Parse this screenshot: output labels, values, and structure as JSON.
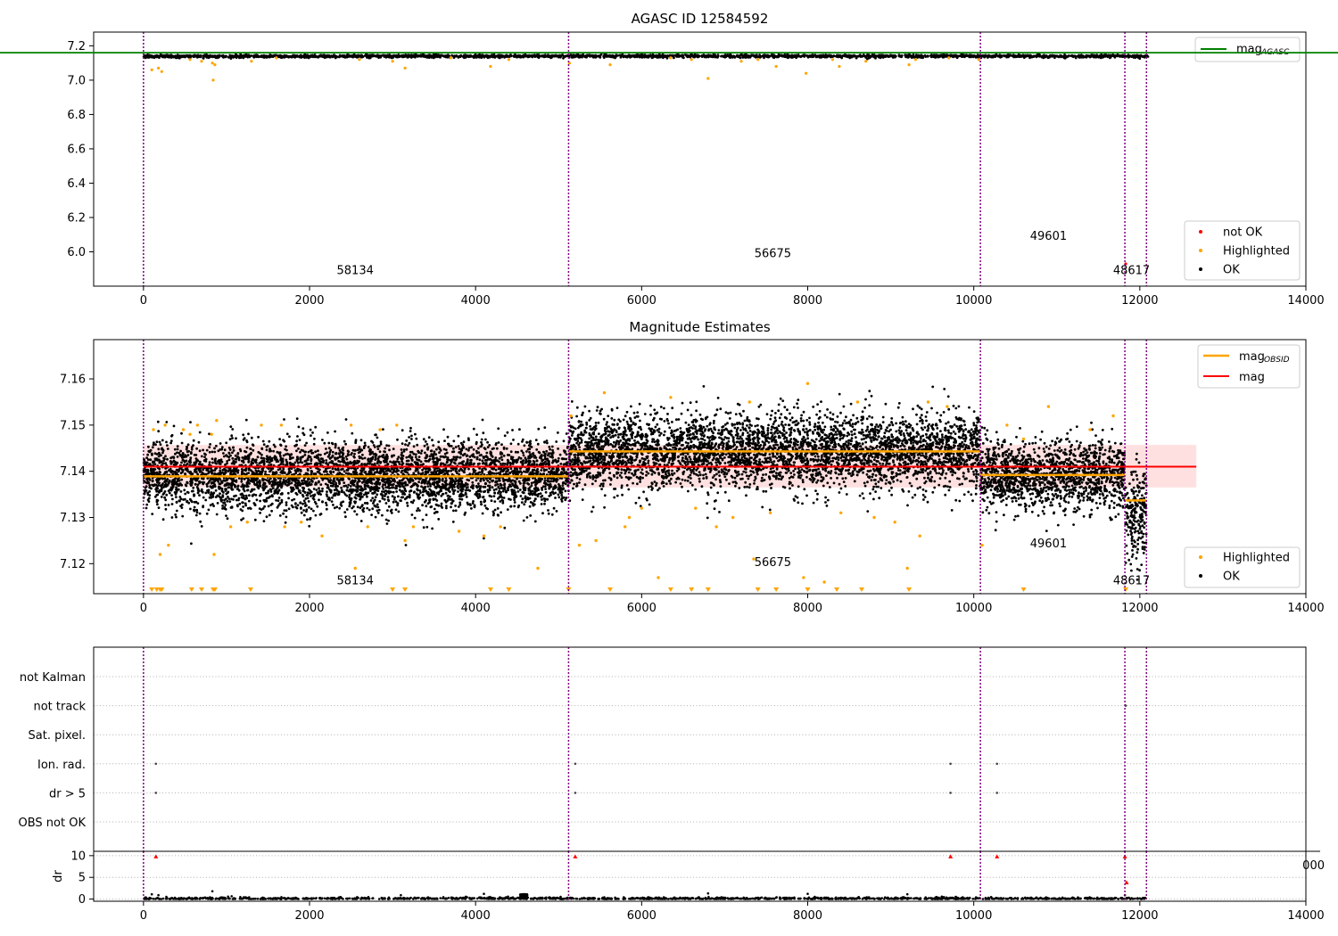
{
  "colors": {
    "ok": "#000000",
    "highlighted": "#ffa500",
    "not_ok": "#ff0000",
    "agasc_line": "#008000",
    "mag_line": "#ff0000",
    "mag_obsid_line": "#ffa500",
    "band": "#ffdddd",
    "obsid_boundary": "#800080"
  },
  "chart_data": [
    {
      "type": "scatter",
      "title": "AGASC ID 12584592",
      "xlim": [
        -600,
        14000
      ],
      "ylim": [
        5.8,
        7.28
      ],
      "x_ticks": [
        0,
        2000,
        4000,
        6000,
        8000,
        10000,
        12000,
        14000
      ],
      "y_ticks": [
        6.0,
        6.2,
        6.4,
        6.6,
        6.8,
        7.0,
        7.2
      ],
      "y_tick_labels": [
        "6.0",
        "6.2",
        "6.4",
        "6.6",
        "6.8",
        "7.0",
        "7.2"
      ],
      "obsid_boundaries": [
        0,
        5120,
        10080,
        11820,
        12080
      ],
      "obsid_labels": [
        {
          "text": "58134",
          "x": 2550,
          "y": 5.87
        },
        {
          "text": "56675",
          "x": 7580,
          "y": 5.97
        },
        {
          "text": "49601",
          "x": 10900,
          "y": 6.07
        },
        {
          "text": "48617",
          "x": 11900,
          "y": 5.87
        }
      ],
      "mag_agasc": 7.16,
      "series": [
        {
          "name": "mag",
          "sub": "AGASC",
          "role": "line"
        },
        {
          "name": "not OK",
          "role": "points"
        },
        {
          "name": "Highlighted",
          "role": "points"
        },
        {
          "name": "OK",
          "role": "points"
        }
      ],
      "legend_line_placement": "top-right",
      "legend_points_placement": "bottom-right",
      "ok_level": 7.14,
      "ok_spread": 0.007,
      "highlighted_points": [
        [
          100,
          7.06
        ],
        [
          180,
          7.07
        ],
        [
          220,
          7.05
        ],
        [
          560,
          7.12
        ],
        [
          700,
          7.11
        ],
        [
          830,
          7.1
        ],
        [
          840,
          7.0
        ],
        [
          860,
          7.09
        ],
        [
          1300,
          7.11
        ],
        [
          1600,
          7.13
        ],
        [
          2600,
          7.12
        ],
        [
          3000,
          7.11
        ],
        [
          3150,
          7.07
        ],
        [
          3700,
          7.13
        ],
        [
          4180,
          7.08
        ],
        [
          4400,
          7.12
        ],
        [
          5130,
          7.1
        ],
        [
          5620,
          7.09
        ],
        [
          6350,
          7.13
        ],
        [
          6600,
          7.12
        ],
        [
          6800,
          7.01
        ],
        [
          7200,
          7.11
        ],
        [
          7400,
          7.12
        ],
        [
          7620,
          7.08
        ],
        [
          7980,
          7.04
        ],
        [
          8300,
          7.12
        ],
        [
          8380,
          7.08
        ],
        [
          8700,
          7.11
        ],
        [
          9220,
          7.09
        ],
        [
          9300,
          7.12
        ],
        [
          9700,
          7.13
        ],
        [
          10060,
          7.12
        ]
      ],
      "not_ok_points": [
        [
          11830,
          5.93
        ]
      ]
    },
    {
      "type": "scatter",
      "title": "Magnitude Estimates",
      "xlim": [
        -600,
        14000
      ],
      "ylim": [
        7.1135,
        7.1685
      ],
      "x_ticks": [
        0,
        2000,
        4000,
        6000,
        8000,
        10000,
        12000,
        14000
      ],
      "y_ticks": [
        7.12,
        7.13,
        7.14,
        7.15,
        7.16
      ],
      "y_tick_labels": [
        "7.12",
        "7.13",
        "7.14",
        "7.15",
        "7.16"
      ],
      "obsid_boundaries": [
        0,
        5120,
        10080,
        11820,
        12080
      ],
      "obsid_labels": [
        {
          "text": "58134",
          "x": 2550,
          "y": 7.1155
        },
        {
          "text": "56675",
          "x": 7580,
          "y": 7.1195
        },
        {
          "text": "49601",
          "x": 10900,
          "y": 7.1235
        },
        {
          "text": "48617",
          "x": 11900,
          "y": 7.1155
        }
      ],
      "mag": 7.141,
      "mag_band": [
        7.1365,
        7.1457
      ],
      "mag_xrange": [
        0,
        12680
      ],
      "mag_obsid": [
        {
          "x0": 0,
          "x1": 5120,
          "y": 7.1389
        },
        {
          "x0": 5120,
          "x1": 10080,
          "y": 7.1443
        },
        {
          "x0": 10080,
          "x1": 11820,
          "y": 7.1392
        },
        {
          "x0": 11820,
          "x1": 12080,
          "y": 7.1337
        }
      ],
      "ok_segments": [
        {
          "x0": 0,
          "x1": 5120,
          "mean": 7.139,
          "sd": 0.0038
        },
        {
          "x0": 5120,
          "x1": 10080,
          "mean": 7.1443,
          "sd": 0.004
        },
        {
          "x0": 10080,
          "x1": 11820,
          "mean": 7.1392,
          "sd": 0.0038
        },
        {
          "x0": 11820,
          "x1": 12080,
          "mean": 7.131,
          "sd": 0.005
        }
      ],
      "series": [
        {
          "name": "mag",
          "sub": "OBSID",
          "role": "line"
        },
        {
          "name": "mag",
          "role": "line"
        },
        {
          "name": "Highlighted",
          "role": "points"
        },
        {
          "name": "OK",
          "role": "points"
        }
      ],
      "legend_line_placement": "top-right",
      "legend_points_placement": "bottom-right",
      "highlighted_points": [
        [
          120,
          7.149
        ],
        [
          200,
          7.122
        ],
        [
          260,
          7.15
        ],
        [
          300,
          7.124
        ],
        [
          480,
          7.149
        ],
        [
          560,
          7.148
        ],
        [
          650,
          7.15
        ],
        [
          820,
          7.148
        ],
        [
          850,
          7.122
        ],
        [
          880,
          7.151
        ],
        [
          1050,
          7.128
        ],
        [
          1250,
          7.129
        ],
        [
          1420,
          7.15
        ],
        [
          1660,
          7.15
        ],
        [
          1700,
          7.128
        ],
        [
          1900,
          7.129
        ],
        [
          2150,
          7.126
        ],
        [
          2500,
          7.15
        ],
        [
          2550,
          7.119
        ],
        [
          2700,
          7.128
        ],
        [
          2850,
          7.149
        ],
        [
          3050,
          7.15
        ],
        [
          3150,
          7.125
        ],
        [
          3250,
          7.128
        ],
        [
          3800,
          7.127
        ],
        [
          4100,
          7.126
        ],
        [
          4300,
          7.128
        ],
        [
          4750,
          7.119
        ],
        [
          5150,
          7.152
        ],
        [
          5250,
          7.124
        ],
        [
          5450,
          7.125
        ],
        [
          5550,
          7.157
        ],
        [
          5800,
          7.128
        ],
        [
          5850,
          7.13
        ],
        [
          6000,
          7.132
        ],
        [
          6200,
          7.117
        ],
        [
          6350,
          7.156
        ],
        [
          6650,
          7.132
        ],
        [
          6900,
          7.128
        ],
        [
          7100,
          7.13
        ],
        [
          7300,
          7.155
        ],
        [
          7350,
          7.121
        ],
        [
          7550,
          7.131
        ],
        [
          7950,
          7.117
        ],
        [
          8000,
          7.159
        ],
        [
          8200,
          7.116
        ],
        [
          8400,
          7.131
        ],
        [
          8600,
          7.155
        ],
        [
          8800,
          7.13
        ],
        [
          9050,
          7.129
        ],
        [
          9200,
          7.119
        ],
        [
          9350,
          7.126
        ],
        [
          9450,
          7.155
        ],
        [
          9680,
          7.154
        ],
        [
          10100,
          7.124
        ],
        [
          10400,
          7.15
        ],
        [
          10600,
          7.147
        ],
        [
          10900,
          7.154
        ],
        [
          11400,
          7.149
        ],
        [
          11680,
          7.152
        ]
      ],
      "floor_points": [
        100,
        160,
        200,
        220,
        580,
        700,
        840,
        860,
        1290,
        3000,
        3150,
        4180,
        4400,
        5120,
        5620,
        6350,
        6600,
        6800,
        7400,
        7620,
        8000,
        8350,
        8650,
        9220,
        10600,
        11830
      ]
    },
    {
      "type": "scatter",
      "title": "",
      "xlim": [
        -600,
        14000
      ],
      "x_ticks": [
        0,
        2000,
        4000,
        6000,
        8000,
        10000,
        12000,
        14000
      ],
      "obsid_boundaries": [
        0,
        5120,
        10080,
        11820,
        12080
      ],
      "flag_labels": [
        "not Kalman",
        "not track",
        "Sat. pixel.",
        "Ion. rad.",
        "dr > 5",
        "OBS not OK"
      ],
      "flag_points": [
        {
          "flag": "not track",
          "x": 11830
        },
        {
          "flag": "Ion. rad.",
          "x": 150
        },
        {
          "flag": "Ion. rad.",
          "x": 5200
        },
        {
          "flag": "Ion. rad.",
          "x": 9720
        },
        {
          "flag": "Ion. rad.",
          "x": 10280
        },
        {
          "flag": "dr > 5",
          "x": 150
        },
        {
          "flag": "dr > 5",
          "x": 5200
        },
        {
          "flag": "dr > 5",
          "x": 9720
        },
        {
          "flag": "dr > 5",
          "x": 10280
        }
      ],
      "dr_ylabel": "dr",
      "dr_ylim": [
        -0.5,
        11
      ],
      "dr_ticks": [
        0,
        5,
        10
      ],
      "dr_tick_labels": [
        "0",
        "5",
        "10"
      ],
      "dr_red_points": [
        [
          150,
          9.8
        ],
        [
          5200,
          9.8
        ],
        [
          9720,
          9.8
        ],
        [
          10280,
          9.8
        ],
        [
          11820,
          9.8
        ],
        [
          11840,
          3.8
        ]
      ],
      "dr_outliers": [
        [
          100,
          1.1
        ],
        [
          180,
          0.9
        ],
        [
          830,
          1.8
        ],
        [
          3100,
          0.9
        ],
        [
          4100,
          1.2
        ],
        [
          4560,
          1.0
        ],
        [
          4600,
          1.1
        ],
        [
          6800,
          1.3
        ],
        [
          8000,
          1.2
        ],
        [
          9200,
          1.1
        ],
        [
          11820,
          0.9
        ]
      ],
      "clipped_tick_label": "000"
    }
  ]
}
